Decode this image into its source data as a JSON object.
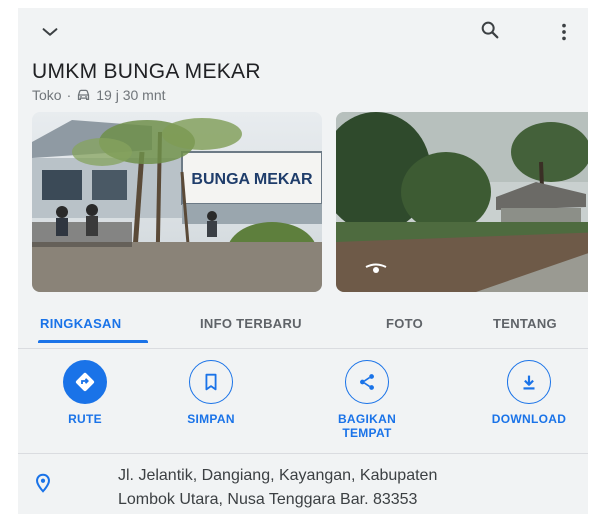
{
  "place": {
    "title": "UMKM BUNGA MEKAR",
    "category": "Toko",
    "separator": "·",
    "travel_time": "19 j 30 mnt",
    "sign_text": "BUNGA MEKAR"
  },
  "icons": {
    "collapse": "chevron-down-icon",
    "search": "search-icon",
    "more": "more-vert-icon",
    "travel_mode": "car-icon",
    "location": "location-pin-icon"
  },
  "tabs": [
    {
      "label": "RINGKASAN",
      "active": true
    },
    {
      "label": "INFO TERBARU",
      "active": false
    },
    {
      "label": "FOTO",
      "active": false
    },
    {
      "label": "TENTANG",
      "active": false
    }
  ],
  "actions": [
    {
      "label": "RUTE",
      "icon": "directions-icon"
    },
    {
      "label": "SIMPAN",
      "icon": "bookmark-icon"
    },
    {
      "label": "BAGIKAN TEMPAT",
      "icon": "share-icon"
    },
    {
      "label": "DOWNLOAD",
      "icon": "download-icon"
    }
  ],
  "address": {
    "line1": "Jl. Jelantik, Dangiang, Kayangan, Kabupaten",
    "line2": "Lombok Utara, Nusa Tenggara Bar. 83353"
  },
  "colors": {
    "accent": "#1a73e8",
    "background": "#f1f3f4",
    "text": "#202124",
    "muted": "#70757a"
  }
}
